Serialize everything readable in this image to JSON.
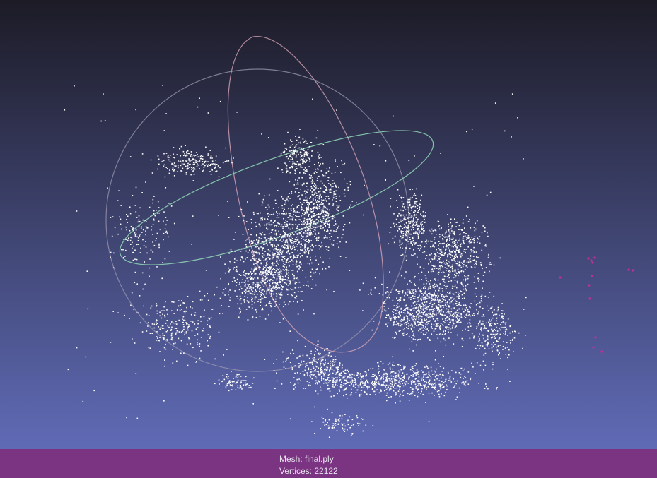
{
  "viewer": {
    "background_top": "#1c1b26",
    "background_bottom": "#6470bf",
    "point_color": "#ffffff",
    "outlier_point_color": "#c0309a",
    "gizmo_colors": {
      "vertical_ring": "#d8a6b8",
      "horizontal_ring": "#8fd3b5",
      "outer_ring": "#9c98b0"
    },
    "info_bar_color": "#7a3482"
  },
  "info": {
    "mesh_label": "Mesh: final.ply",
    "vertices_label": "Vertices: 22122"
  }
}
